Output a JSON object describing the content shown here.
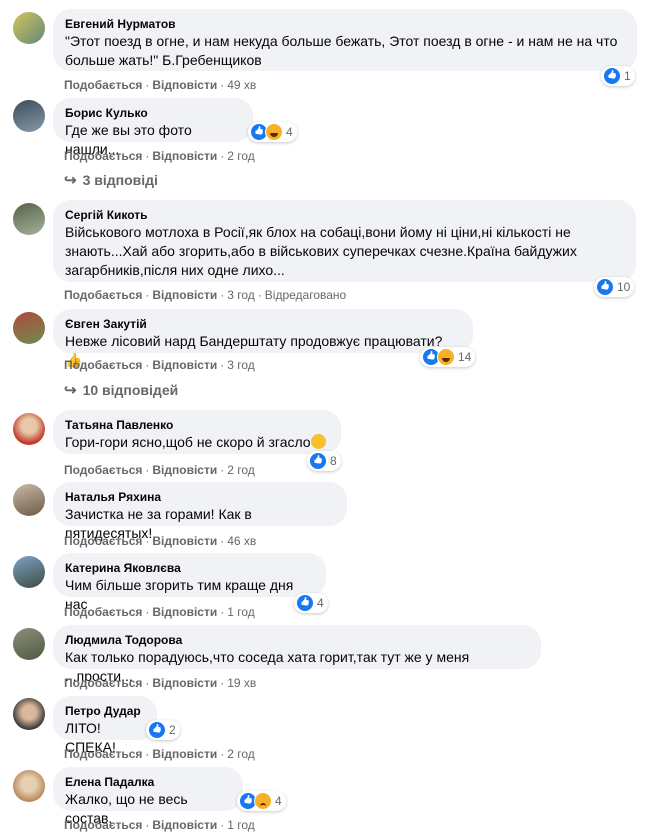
{
  "labels": {
    "like": "Подобається",
    "reply": "Відповісти",
    "edited": "Відредаговано"
  },
  "comments": [
    {
      "author": "Евгений Нурматов",
      "lines": [
        "\"Этот поезд в огне, и нам некуда больше бежать, Этот поезд в огне - и нам не на что",
        "больше жать!\" Б.Гребенщиков"
      ],
      "time": "49 хв",
      "reactions": "1"
    },
    {
      "author": "Борис Кулько",
      "lines": [
        "Где же вы это фото нашли..."
      ],
      "time": "2 год",
      "reactions": "4",
      "replies": "3 відповіді"
    },
    {
      "author": "Сергій Кикоть",
      "lines": [
        "Військового мотлоха в Росії,як блох на собаці,вони йому ні ціни,ні кількості не",
        "знають...Хай або згорить,або в військових суперечках счезне.Країна байдужих",
        "загарбників,після них одне лихо..."
      ],
      "time": "3 год",
      "reactions": "10"
    },
    {
      "author": "Євген Закутій",
      "lines": [
        "Невже лісовий нард Бандерштату продовжує працювати?"
      ],
      "time": "3 год",
      "reactions": "14",
      "replies": "10 відповідей"
    },
    {
      "author": "Татьяна Павленко",
      "lines": [
        "Гори-гори ясно,щоб не скоро й згасло"
      ],
      "time": "2 год",
      "reactions": "8"
    },
    {
      "author": "Наталья Ряхина",
      "lines": [
        "Зачистка не за горами! Как в пятидесятых!"
      ],
      "time": "46 хв"
    },
    {
      "author": "Катерина Яковлєва",
      "lines": [
        "Чим більше згорить тим краще дня нас"
      ],
      "time": "1 год",
      "reactions": "4"
    },
    {
      "author": "Людмила Тодорова",
      "lines": [
        "Как только порадуюсь,что соседа хата горит,так тут же у меня ...прости..."
      ],
      "time": "19 хв"
    },
    {
      "author": "Петро Дудар",
      "lines": [
        "ЛІТО!СПЕКА!"
      ],
      "time": "2 год",
      "reactions": "2"
    },
    {
      "author": "Елена Падалка",
      "lines": [
        "Жалко, що не весь состав."
      ],
      "time": "1 год",
      "reactions": "4"
    }
  ],
  "colors": {
    "bubble": "#f0f2f5",
    "meta": "#65676b",
    "like": "#1877f2",
    "emoji": "#f7b125"
  }
}
